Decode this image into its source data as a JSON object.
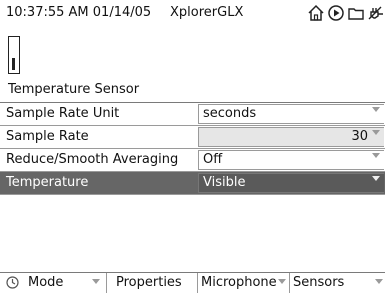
{
  "status_bar": {
    "time": "10:37:55 AM",
    "date": "01/14/05",
    "app_title": "XplorerGLX",
    "icons": [
      "home-icon",
      "play-icon",
      "folder-icon",
      "power-plug-icon"
    ]
  },
  "sensor": {
    "icon": "thermometer-sensor-icon",
    "title": "Temperature Sensor"
  },
  "settings": {
    "rows": [
      {
        "label": "Sample Rate Unit",
        "value": "seconds"
      },
      {
        "label": "Sample Rate",
        "value": "30"
      },
      {
        "label": "Reduce/Smooth Averaging",
        "value": "Off"
      },
      {
        "label": "Temperature",
        "value": "Visible"
      }
    ],
    "selected_index": 3
  },
  "soft_keys": {
    "mode": "Mode",
    "properties": "Properties",
    "microphone": "Microphone",
    "sensors": "Sensors",
    "mode_icon": "clock-icon"
  },
  "colors": {
    "selected_row_bg": "#666666",
    "border": "#9a9a9a",
    "shaded_field": "#e6e6e6"
  }
}
